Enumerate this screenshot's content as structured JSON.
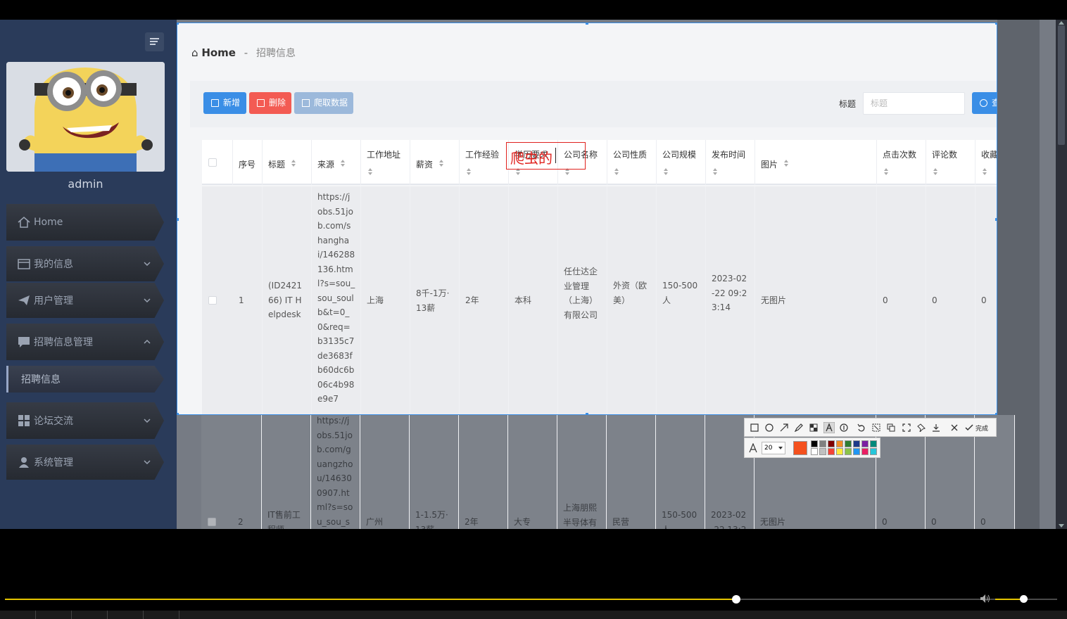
{
  "sidebar": {
    "username": "admin",
    "items": [
      {
        "label": "Home",
        "icon": "home-icon"
      },
      {
        "label": "我的信息",
        "icon": "card-icon"
      },
      {
        "label": "用户管理",
        "icon": "paper-plane-icon"
      },
      {
        "label": "招聘信息管理",
        "icon": "chat-icon"
      },
      {
        "label": "招聘信息",
        "icon": ""
      },
      {
        "label": "论坛交流",
        "icon": "grid-icon"
      },
      {
        "label": "系统管理",
        "icon": "user-icon"
      }
    ]
  },
  "breadcrumb": {
    "home": "Home",
    "separator": "-",
    "current": "招聘信息"
  },
  "toolbar": {
    "add_label": "新增",
    "delete_label": "删除",
    "crawl_label": "爬取数据",
    "search_label": "标题",
    "search_placeholder": "标题",
    "query_label": "查询"
  },
  "table": {
    "columns": [
      "序号",
      "标题",
      "来源",
      "工作地址",
      "薪资",
      "工作经验",
      "学历要求",
      "公司名称",
      "公司性质",
      "公司规模",
      "发布时间",
      "图片",
      "点击次数",
      "评论数",
      "收藏数"
    ],
    "rows": [
      {
        "index": "1",
        "title": "(ID2421\n66) IT H\nelpdesk",
        "source": "https://j\nobs.51jo\nb.com/s\nhangha\ni/146288\n136.htm\nl?s=sou_\nsou_soul\nb&t=0_\n0&req=\nb3135c7\nde3683f\nb60dc6b\n06c4b98\ne9e7",
        "address": "上海",
        "salary": "8千-1万·\n13薪",
        "experience": "2年",
        "education": "本科",
        "company": "任仕达企\n业管理\n（上海）\n有限公司",
        "nature": "外资（欧\n美）",
        "scale": "150-500\n人",
        "published": "2023-02\n-22 09:2\n3:14",
        "image": "无图片",
        "clicks": "0",
        "comments": "0",
        "favorites": "0"
      },
      {
        "index": "2",
        "title": "IT售前工\n程师",
        "source": "https://j\nobs.51jo\nb.com/g\nuangzho\nu/14630\n0907.ht\nml?s=so\nu_sou_s",
        "address": "广州",
        "salary": "1-1.5万·\n13薪",
        "experience": "2年",
        "education": "大专",
        "company": "上海朋熙\n半导体有",
        "nature": "民营",
        "scale": "150-500\n人",
        "published": "2023-02\n-22 13:2",
        "image": "无图片",
        "clicks": "0",
        "comments": "0",
        "favorites": "0"
      }
    ]
  },
  "annotation": {
    "text": "爬虫的",
    "color": "#e0221e"
  },
  "snip_tool": {
    "done_label": "完成",
    "font_size": "20",
    "current_color": "#f4511e",
    "palette": [
      "#000000",
      "#808080",
      "#800000",
      "#f28c28",
      "#2e7d32",
      "#1e3a8a",
      "#7b1fa2",
      "#00897b",
      "#ffffff",
      "#c0c0c0",
      "#f44336",
      "#ffeb3b",
      "#8bc34a",
      "#2196f3",
      "#e91e63",
      "#26c6da"
    ]
  },
  "player": {
    "progress": 0.696,
    "volume": 0.45
  },
  "colors": {
    "primary": "#3a8ee6",
    "danger": "#f35b53",
    "sidebar": "#2a3b5a",
    "accent_yellow": "#e4c400"
  }
}
